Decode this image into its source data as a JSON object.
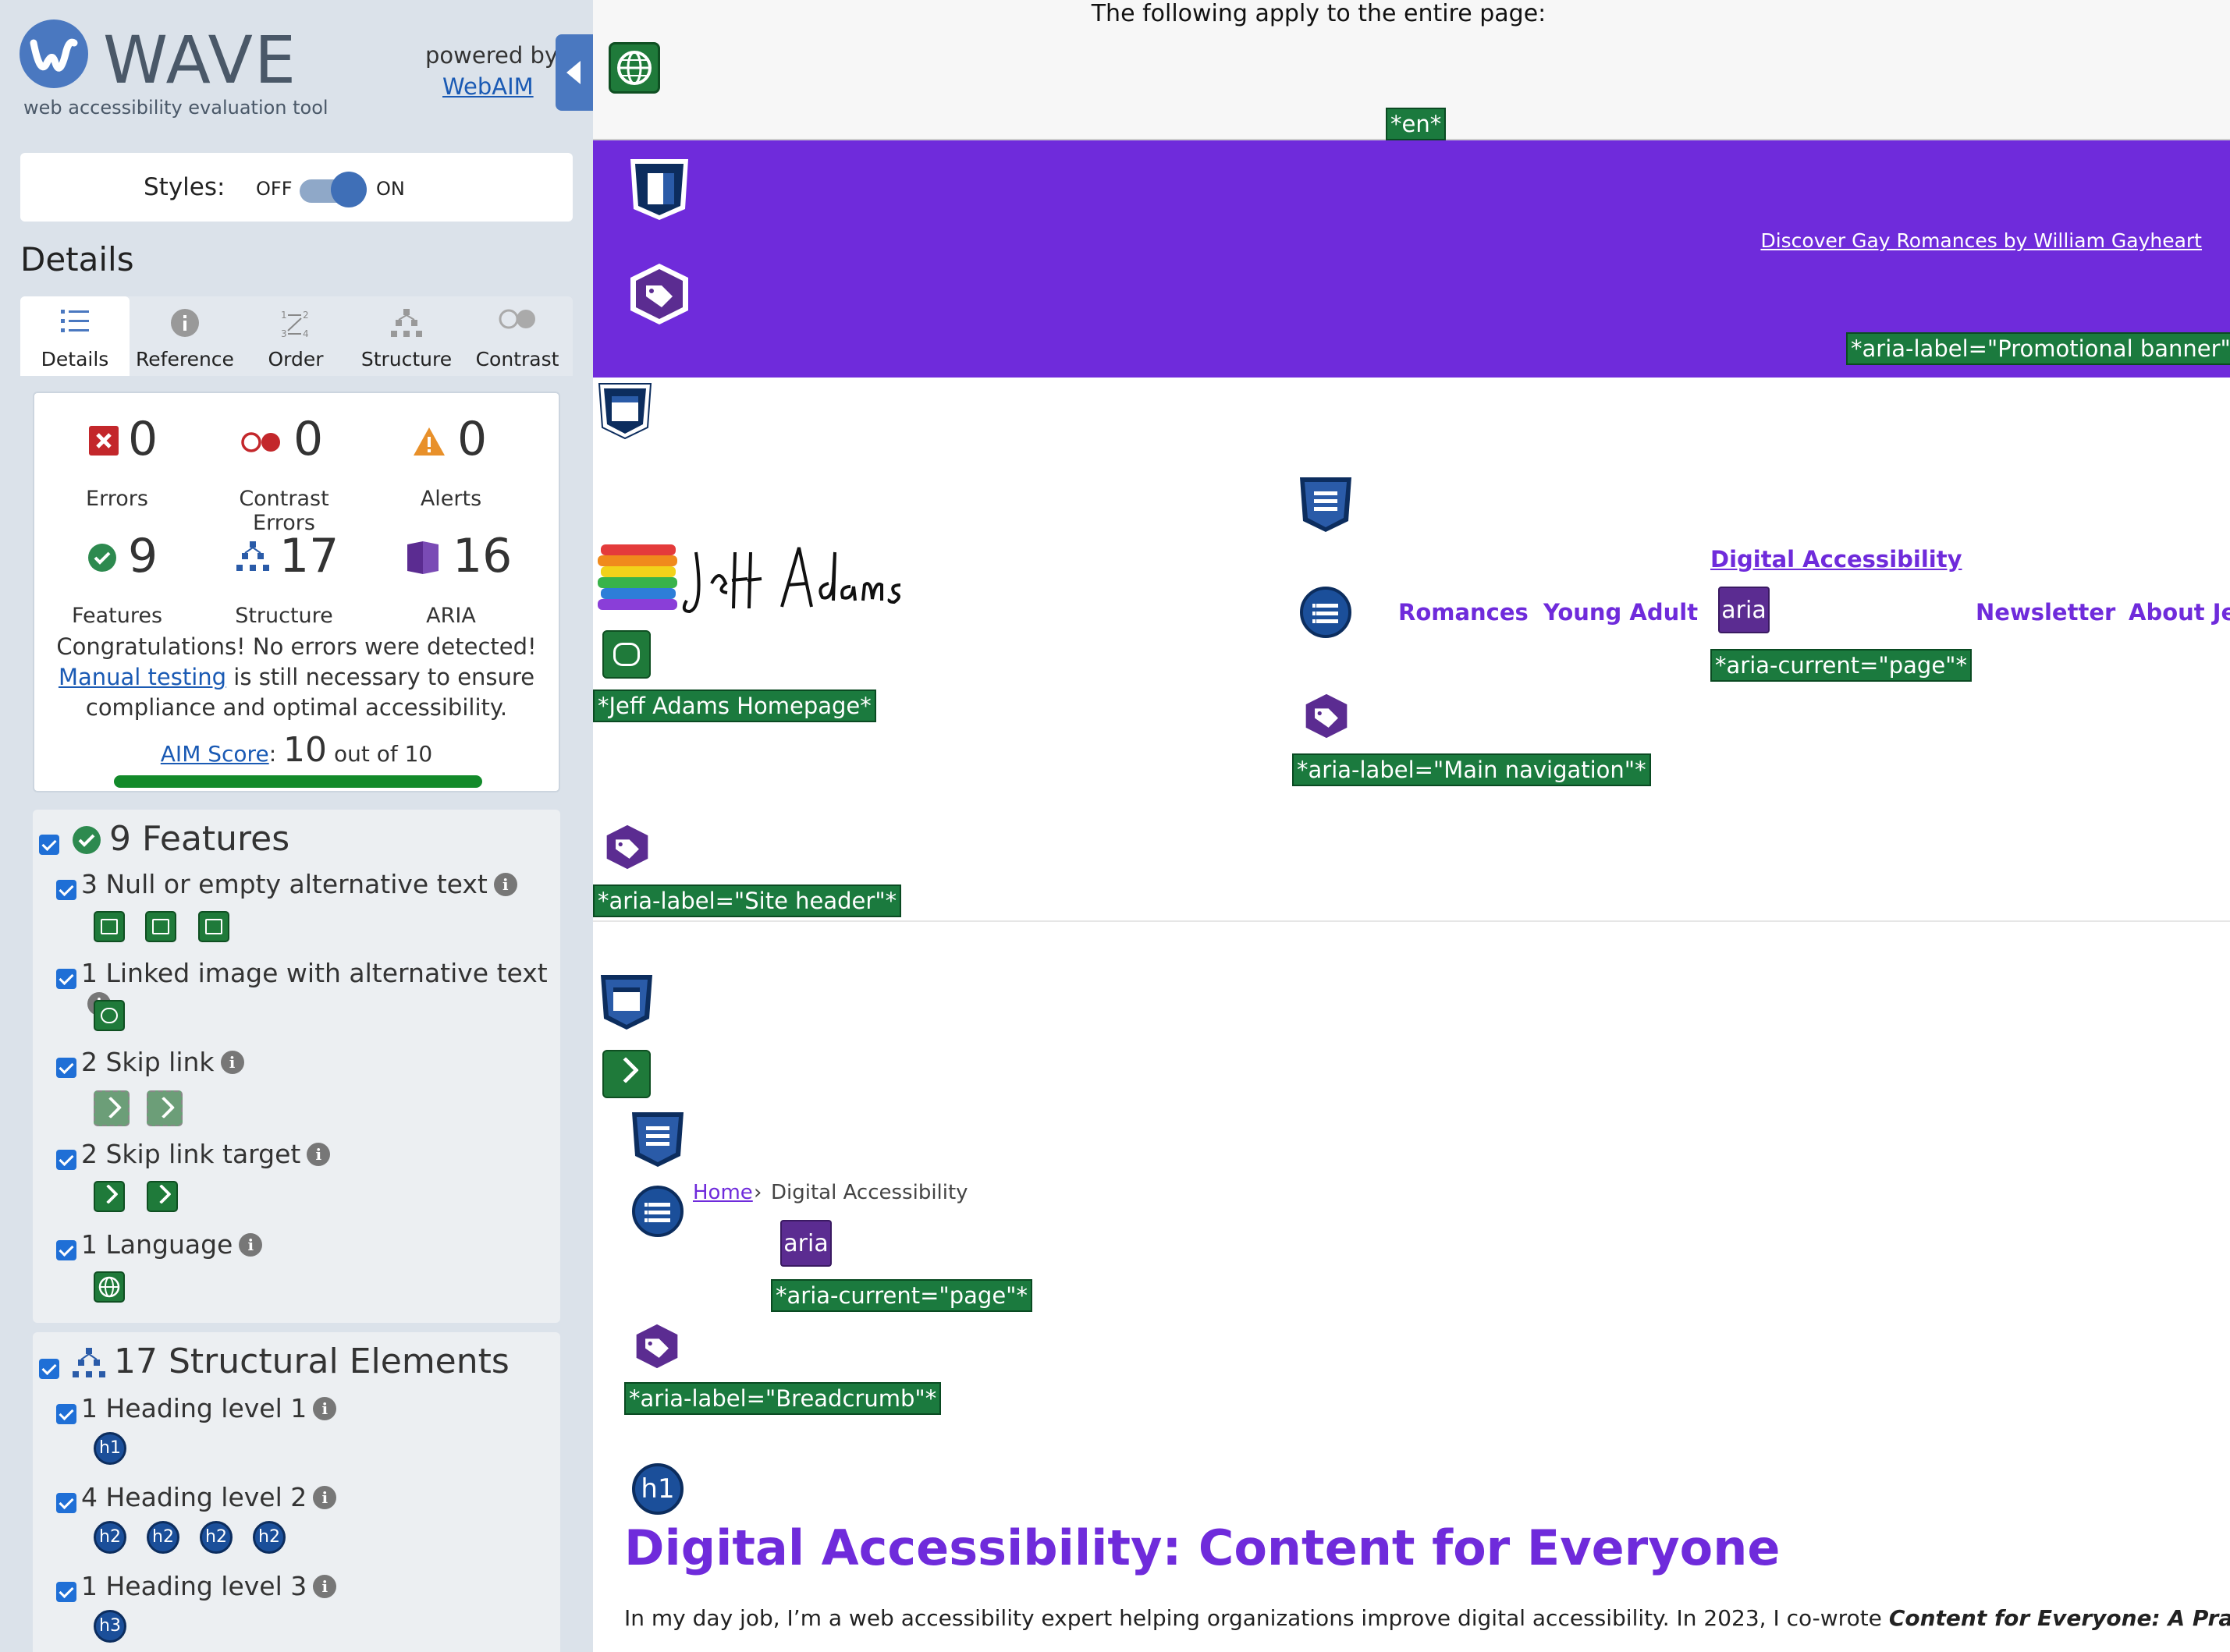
{
  "sidebar": {
    "brand": "WAVE",
    "tagline": "web accessibility evaluation tool",
    "powered_by": "powered by",
    "webaim_link": "WebAIM",
    "styles_label": "Styles:",
    "off_label": "OFF",
    "on_label": "ON",
    "details_title": "Details",
    "tabs": [
      {
        "label": "Details",
        "icon": "list-icon",
        "active": true
      },
      {
        "label": "Reference",
        "icon": "info-icon",
        "active": false
      },
      {
        "label": "Order",
        "icon": "order-icon",
        "active": false
      },
      {
        "label": "Structure",
        "icon": "structure-icon",
        "active": false
      },
      {
        "label": "Contrast",
        "icon": "contrast-icon",
        "active": false
      }
    ],
    "summary": {
      "errors": {
        "count": "0",
        "label": "Errors"
      },
      "contrast": {
        "count": "0",
        "label": "Contrast Errors"
      },
      "alerts": {
        "count": "0",
        "label": "Alerts"
      },
      "features": {
        "count": "9",
        "label": "Features"
      },
      "structure": {
        "count": "17",
        "label": "Structure"
      },
      "aria": {
        "count": "16",
        "label": "ARIA"
      },
      "congrats_pre": "Congratulations! No errors were detected! ",
      "manual_link": "Manual testing",
      "congrats_post": " is still necessary to ensure compliance and optimal accessibility.",
      "aim_link": "AIM Score",
      "aim_colon": ":",
      "aim_score": "10",
      "aim_out_of": "out of 10",
      "aim_fraction": 1.0
    },
    "features_panel": {
      "heading": "9 Features",
      "items": [
        {
          "label": "3 Null or empty alternative text",
          "icon_count": 3
        },
        {
          "label": "1 Linked image with alternative text",
          "icon_count": 1
        },
        {
          "label": "2 Skip link",
          "icon_count": 2
        },
        {
          "label": "2 Skip link target",
          "icon_count": 2
        },
        {
          "label": "1 Language",
          "icon_count": 1
        }
      ]
    },
    "structure_panel": {
      "heading": "17 Structural Elements",
      "items": [
        {
          "label": "1 Heading level 1",
          "badge": "h1",
          "icon_count": 1
        },
        {
          "label": "4 Heading level 2",
          "badge": "h2",
          "icon_count": 4
        },
        {
          "label": "1 Heading level 3",
          "badge": "h3",
          "icon_count": 1
        }
      ]
    }
  },
  "page": {
    "apply_text": "The following apply to the entire page:",
    "lang_tag": "*en*",
    "promo_link": "Discover Gay Romances by William Gayheart",
    "promo_tag": "*aria-label=\"Promotional banner\"*",
    "logo_alt_tag": "*Jeff Adams Homepage*",
    "nav": {
      "items": [
        "Romances",
        "Young Adult",
        "Digital Accessibility",
        "Newsletter",
        "About Jeff"
      ],
      "aria_current_tag": "*aria-current=\"page\"*",
      "nav_tag": "*aria-label=\"Main navigation\"*"
    },
    "site_header_tag": "*aria-label=\"Site header\"*",
    "aria_badge": "aria",
    "breadcrumb": {
      "home": "Home",
      "sep": "›",
      "current": "Digital Accessibility",
      "aria_current_tag": "*aria-current=\"page\"*",
      "label_tag": "*aria-label=\"Breadcrumb\"*"
    },
    "h1_badge": "h1",
    "h1": "Digital Accessibility: Content for Everyone",
    "intro_pre": "In my day job, I’m a web accessibility expert helping organizations improve digital accessibility. In 2023, I co-wrote ",
    "intro_bold": "Content for Everyone: A Practical Guide"
  },
  "colors": {
    "wave_blue": "#4a78c0",
    "sidebar_bg": "#dbe2ea",
    "wave_green": "#1b7a3e",
    "purple": "#6f2bdb",
    "aria_purple": "#5b2c91",
    "structure_blue": "#1b4f9a"
  }
}
